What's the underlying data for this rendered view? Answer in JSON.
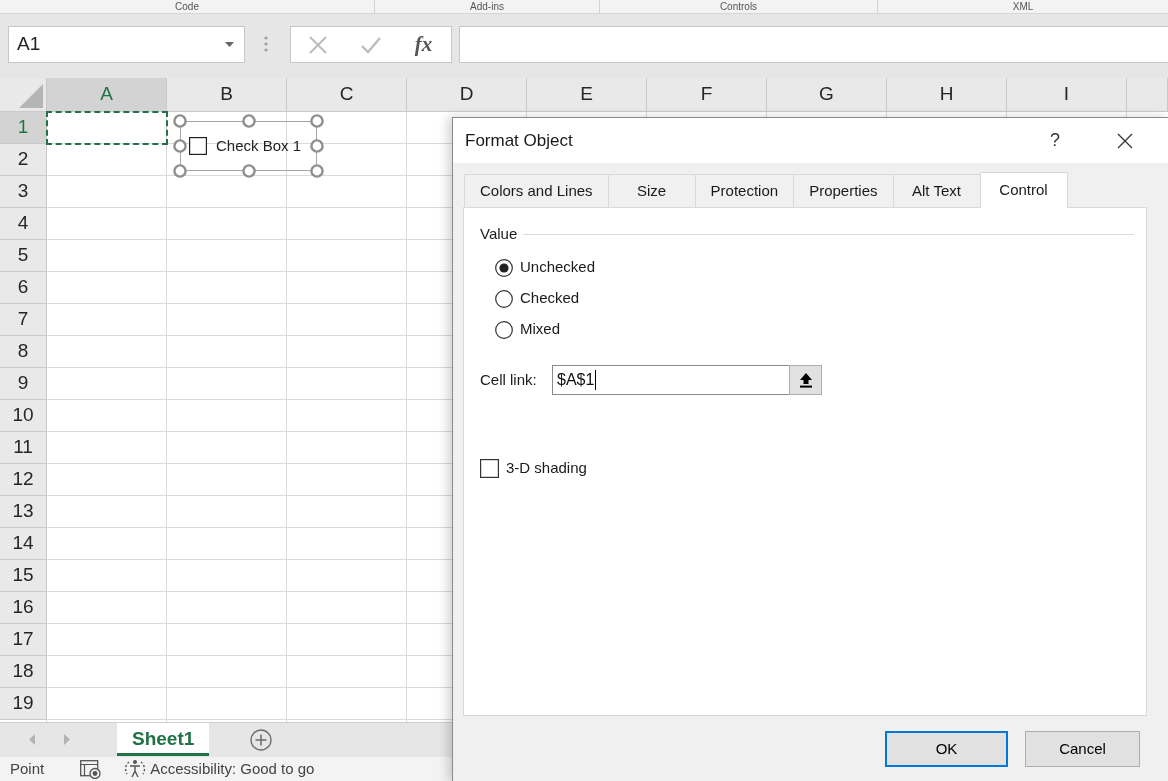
{
  "ribbon_groups": [
    "Code",
    "Add-ins",
    "Controls",
    "XML"
  ],
  "formula_bar": {
    "name_box": "A1",
    "buttons": [
      {
        "kind": "cancel",
        "disabled": true
      },
      {
        "kind": "enter",
        "disabled": true
      },
      {
        "kind": "function",
        "label": "fx",
        "disabled": false
      }
    ]
  },
  "columns": [
    {
      "label": "A",
      "selected": true
    },
    {
      "label": "B",
      "selected": false
    },
    {
      "label": "C",
      "selected": false
    },
    {
      "label": "D",
      "selected": false
    },
    {
      "label": "E",
      "selected": false
    },
    {
      "label": "F",
      "selected": false
    },
    {
      "label": "G",
      "selected": false
    },
    {
      "label": "H",
      "selected": false
    },
    {
      "label": "I",
      "selected": false
    }
  ],
  "rows": [
    {
      "label": "1",
      "selected": true
    },
    {
      "label": "2",
      "selected": false
    },
    {
      "label": "3",
      "selected": false
    },
    {
      "label": "4",
      "selected": false
    },
    {
      "label": "5",
      "selected": false
    },
    {
      "label": "6",
      "selected": false
    },
    {
      "label": "7",
      "selected": false
    },
    {
      "label": "8",
      "selected": false
    },
    {
      "label": "9",
      "selected": false
    },
    {
      "label": "10",
      "selected": false
    },
    {
      "label": "11",
      "selected": false
    },
    {
      "label": "12",
      "selected": false
    },
    {
      "label": "13",
      "selected": false
    },
    {
      "label": "14",
      "selected": false
    },
    {
      "label": "15",
      "selected": false
    },
    {
      "label": "16",
      "selected": false
    },
    {
      "label": "17",
      "selected": false
    },
    {
      "label": "18",
      "selected": false
    },
    {
      "label": "19",
      "selected": false
    }
  ],
  "reference_marquee": true,
  "form_control": {
    "label": "Check Box 1",
    "checked": false,
    "selected": true
  },
  "sheet_tabs": [
    {
      "label": "Sheet1",
      "selected": true
    }
  ],
  "status_bar": {
    "mode": "Point",
    "accessibility": "Accessibility: Good to go"
  },
  "dialog": {
    "title": "Format Object",
    "help": "?",
    "tabs": [
      {
        "label": "Colors and Lines",
        "selected": false
      },
      {
        "label": "Size",
        "selected": false
      },
      {
        "label": "Protection",
        "selected": false
      },
      {
        "label": "Properties",
        "selected": false
      },
      {
        "label": "Alt Text",
        "selected": false
      },
      {
        "label": "Control",
        "selected": true
      }
    ],
    "value_group": {
      "legend": "Value",
      "options": [
        {
          "label": "Unchecked",
          "selected": true
        },
        {
          "label": "Checked",
          "selected": false
        },
        {
          "label": "Mixed",
          "selected": false
        }
      ]
    },
    "cell_link": {
      "label": "Cell link:",
      "value": "$A$1",
      "focused": true
    },
    "shading": {
      "label": "3-D shading",
      "checked": false
    },
    "buttons": [
      {
        "label": "OK",
        "default": true
      },
      {
        "label": "Cancel",
        "default": false
      }
    ]
  }
}
